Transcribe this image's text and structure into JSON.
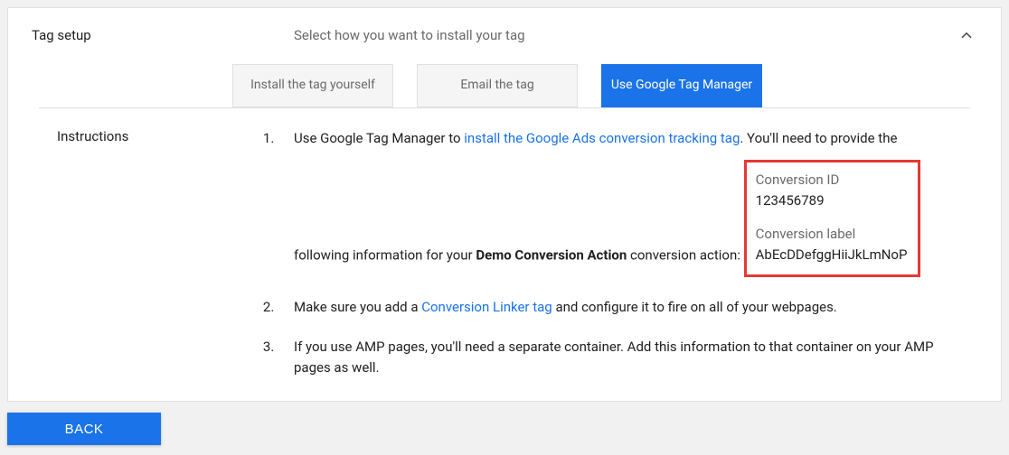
{
  "panel": {
    "title": "Tag setup",
    "subtitle": "Select how you want to install your tag"
  },
  "tabs": {
    "install_yourself": "Install the tag yourself",
    "email_tag": "Email the tag",
    "use_gtm": "Use Google Tag Manager"
  },
  "instructions_label": "Instructions",
  "step1": {
    "prefix": "Use Google Tag Manager to ",
    "link": "install the Google Ads conversion tracking tag",
    "mid": ". You'll need to provide the following information for your ",
    "bold": "Demo Conversion Action",
    "suffix": " conversion action:"
  },
  "conversion": {
    "id_label": "Conversion ID",
    "id_value": "123456789",
    "label_label": "Conversion label",
    "label_value": "AbEcDDefggHiiJkLmNoP"
  },
  "step2": {
    "prefix": "Make sure you add a ",
    "link": "Conversion Linker tag",
    "suffix": " and configure it to fire on all of your webpages."
  },
  "step3": "If you use AMP pages, you'll need a separate container. Add this information to that container on your AMP pages as well.",
  "back_button": "BACK"
}
